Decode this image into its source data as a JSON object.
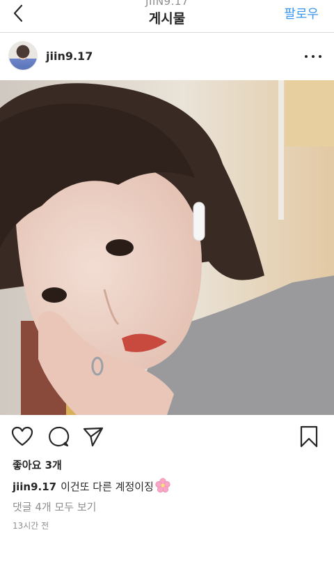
{
  "header": {
    "subtitle": "JIIN9.17",
    "title": "게시물",
    "follow_label": "팔로우"
  },
  "post": {
    "username": "jiin9.17",
    "likes_text": "좋아요 3개",
    "caption_user": "jiin9.17",
    "caption_text": "이건또 다른 계정이징",
    "caption_emoji": "cherry-blossom-emoji",
    "view_comments": "댓글 4개 모두 보기",
    "timestamp": "13시간 전"
  },
  "icons": {
    "back": "chevron-left-icon",
    "more": "more-dots-icon",
    "like": "heart-icon",
    "comment": "comment-bubble-icon",
    "share": "paper-plane-icon",
    "save": "bookmark-icon"
  },
  "colors": {
    "accent": "#3897f0",
    "text": "#262626",
    "muted": "#8e8e8e",
    "divider": "#dbdbdb"
  }
}
